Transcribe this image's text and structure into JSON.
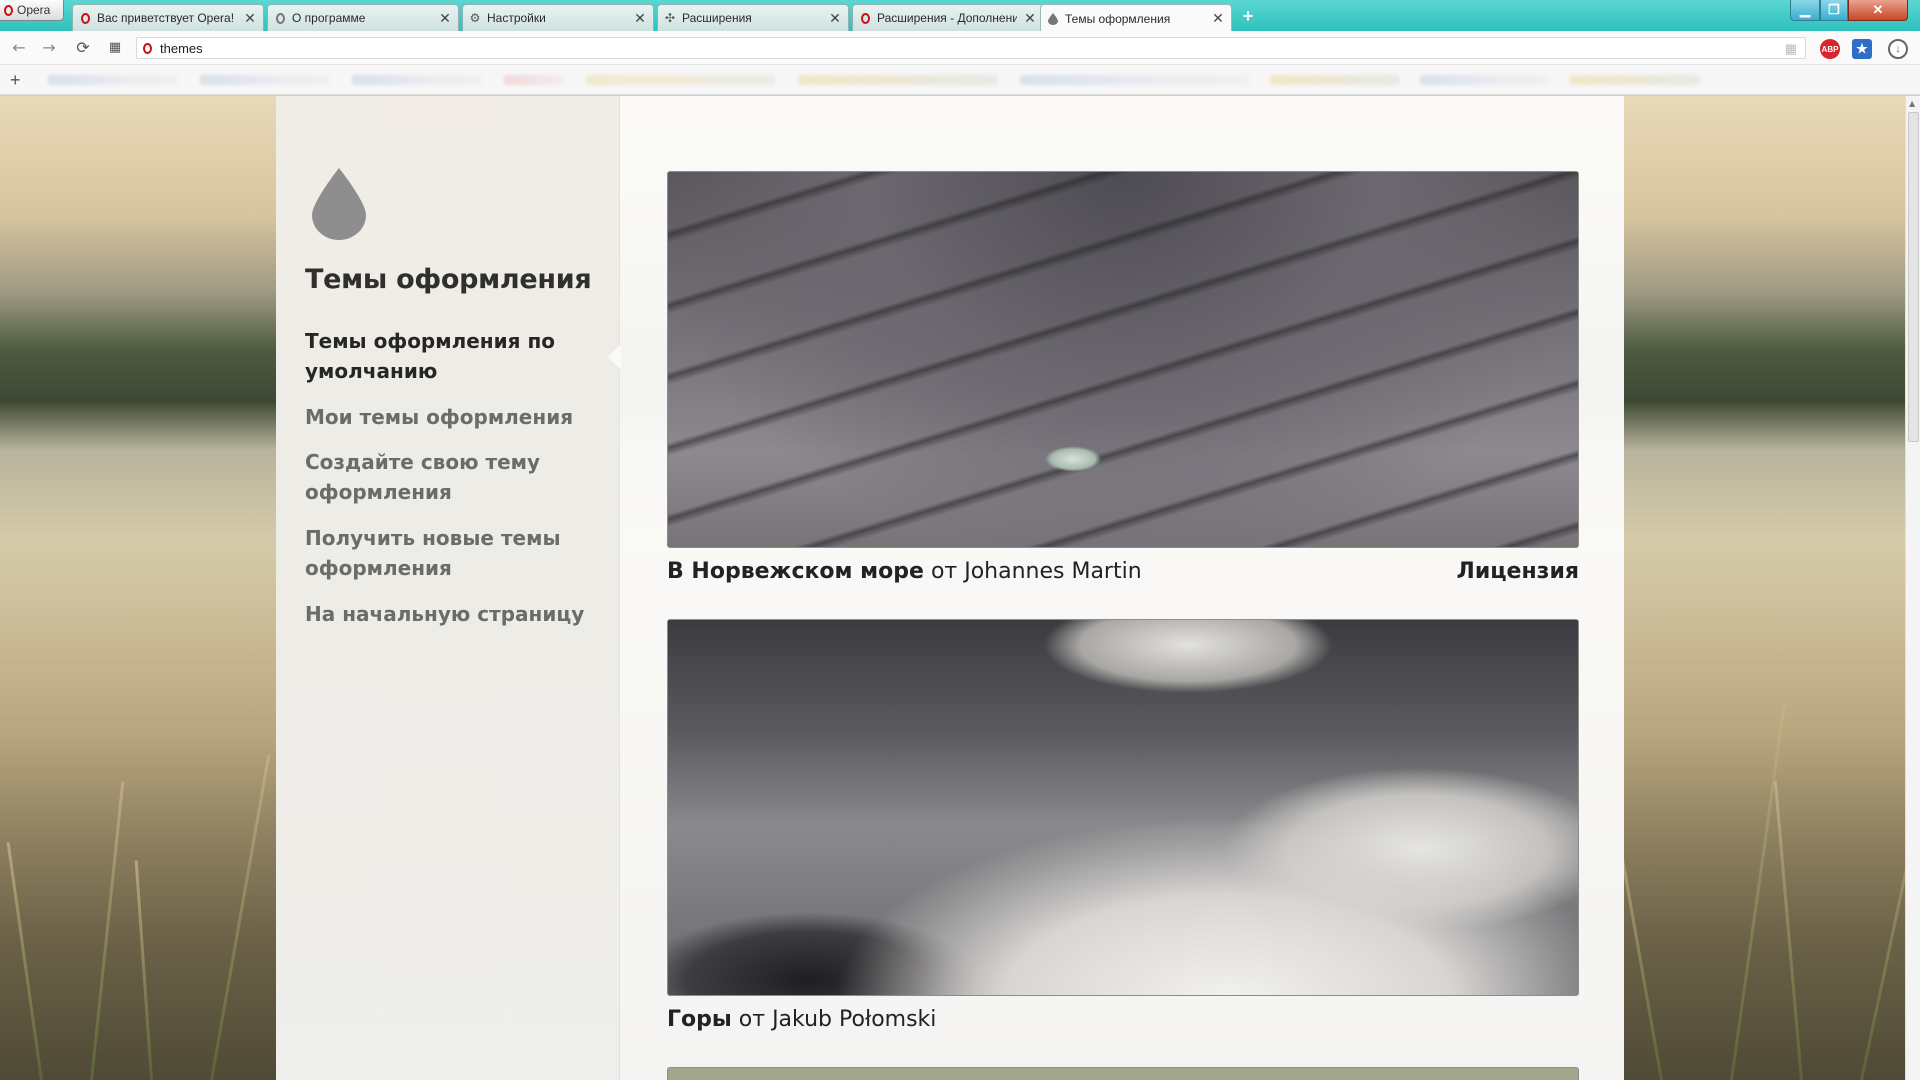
{
  "browser": {
    "menu_label": "Opera",
    "tabs": [
      {
        "title": "Вас приветствует Opera!",
        "icon": "opera-icon",
        "active": false
      },
      {
        "title": "О программе",
        "icon": "opera-icon",
        "active": false
      },
      {
        "title": "Настройки",
        "icon": "gear-icon",
        "active": false
      },
      {
        "title": "Расширения",
        "icon": "puzzle-icon",
        "active": false
      },
      {
        "title": "Расширения - Дополнения",
        "icon": "opera-icon",
        "active": false
      },
      {
        "title": "Темы оформления",
        "icon": "drop-icon",
        "active": true
      }
    ],
    "address": "themes"
  },
  "sidebar": {
    "title": "Темы оформления",
    "items": [
      {
        "label": "Темы оформления по умолчанию",
        "selected": true
      },
      {
        "label": "Мои темы оформления",
        "selected": false
      },
      {
        "label": "Создайте свою тему оформления",
        "selected": false
      },
      {
        "label": "Получить новые темы оформления",
        "selected": false
      },
      {
        "label": "На начальную страницу",
        "selected": false
      }
    ]
  },
  "themes": [
    {
      "name": "В Норвежском море",
      "by": "от",
      "author": "Johannes Martin",
      "license": "Лицензия"
    },
    {
      "name": "Горы",
      "by": "от",
      "author": "Jakub Połomski"
    }
  ],
  "colors": {
    "tab_bar": "#2fc1bd",
    "opera_red": "#cc0f16",
    "text_dark": "#262626",
    "text_muted": "#6b6b6b"
  }
}
